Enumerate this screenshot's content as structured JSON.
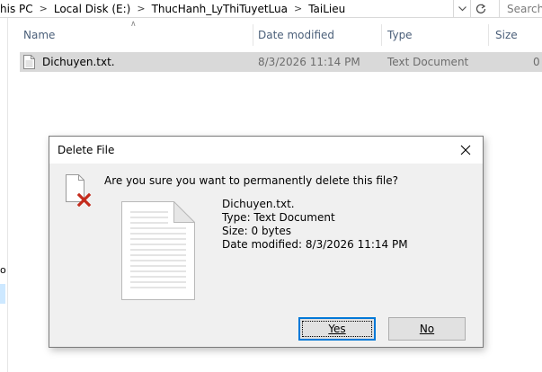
{
  "address_bar": {
    "crumbs": [
      "his PC",
      "Local Disk (E:)",
      "ThucHanh_LyThiTuyetLua",
      "TaiLieu"
    ],
    "search_placeholder": "Search"
  },
  "nav_pane": {
    "fragment": "o"
  },
  "columns": {
    "name": "Name",
    "date": "Date modified",
    "type": "Type",
    "size": "Size"
  },
  "file": {
    "name": "Dichuyen.txt.",
    "date": "8/3/2026 11:14 PM",
    "type": "Text Document",
    "size": "0"
  },
  "dialog": {
    "title": "Delete File",
    "question": "Are you sure you want to permanently delete this file?",
    "details": {
      "name": "Dichuyen.txt.",
      "type": "Type: Text Document",
      "size": "Size: 0 bytes",
      "modified": "Date modified: 8/3/2026 11:14 PM"
    },
    "yes_button": "Yes",
    "no_button": "No"
  },
  "icons": {
    "close": "close-icon",
    "delete_file": "delete-file-icon",
    "document": "text-document-icon",
    "refresh": "refresh-icon",
    "dropdown": "chevron-down-icon"
  },
  "colors": {
    "delete_x": "#c42b1c",
    "selection": "#d9d9d9",
    "default_button_border": "#0078d7",
    "header_text": "#4c607a"
  }
}
